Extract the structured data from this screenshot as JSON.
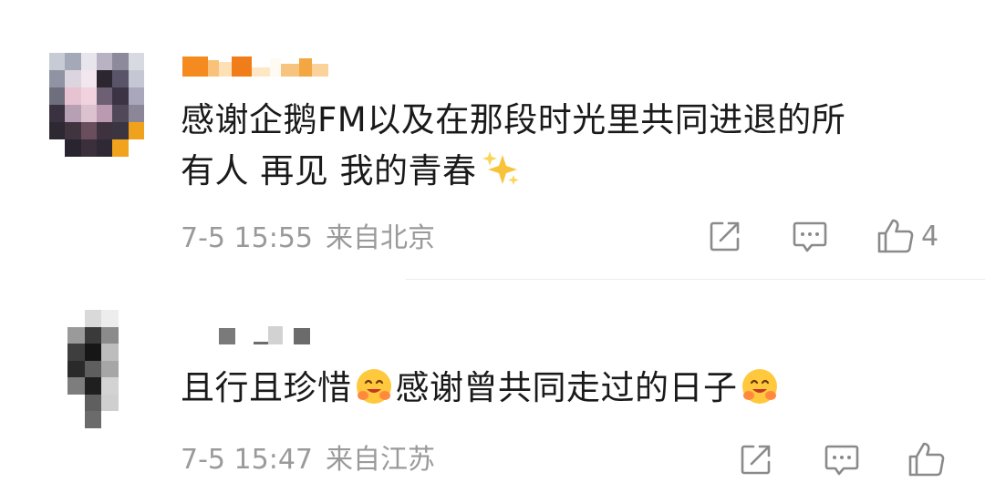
{
  "comments": [
    {
      "text_line1": "感谢企鹅FM以及在那段时光里共同进退的所",
      "text_line2": "有人 再见 我的青春",
      "trailing_emoji": "sparkles-emoji",
      "time": "7-5 15:55",
      "location": "来自北京",
      "like_count": "4",
      "icons": [
        "share-icon",
        "comment-icon",
        "like-icon"
      ]
    },
    {
      "text_part1": "且行且珍惜",
      "text_part2": "感谢曾共同走过的日子",
      "inline_emoji": "hugging-face-emoji",
      "time": "7-5 15:47",
      "location": "来自江苏",
      "like_count": "",
      "icons": [
        "share-icon",
        "comment-icon",
        "like-icon"
      ]
    }
  ],
  "colors": {
    "text": "#1a1a1a",
    "meta": "#9a9a9a",
    "icon": "#8a8a8a",
    "username_bar": "#f39a2b",
    "divider": "#ececec"
  }
}
